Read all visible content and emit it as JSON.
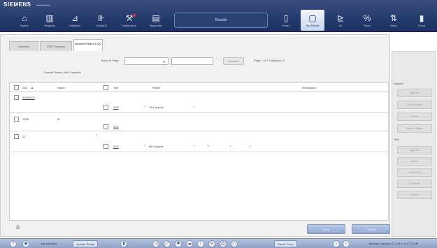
{
  "header": {
    "brand": "SIEMENS",
    "results_label": "Results",
    "nav_left": [
      {
        "label": "System",
        "icon": "home-icon"
      },
      {
        "label": "Reagents",
        "icon": "reagents-icon"
      },
      {
        "label": "Calibration",
        "icon": "calibration-icon"
      },
      {
        "label": "QualityCtl",
        "icon": "quality-control-icon"
      },
      {
        "label": "Maintenance",
        "icon": "maintenance-icon"
      },
      {
        "label": "Diagnostics",
        "icon": "diagnostics-icon"
      }
    ],
    "nav_right": [
      {
        "label": "Orders",
        "icon": "orders-icon"
      },
      {
        "label": "Test Results",
        "icon": "test-results-icon",
        "active": true
      },
      {
        "label": "QC",
        "icon": "qc-icon"
      },
      {
        "label": "Racks",
        "icon": "racks-icon"
      },
      {
        "label": "Status",
        "icon": "status-icon"
      },
      {
        "label": "Events",
        "icon": "events-icon"
      }
    ]
  },
  "tabs": [
    {
      "label": "Overview"
    },
    {
      "label": "STAT Samples"
    },
    {
      "label": "Worklist Patient & QC",
      "active": true
    }
  ],
  "filter": {
    "per_page_label": "Rows in Page",
    "search_button": "Retrieve",
    "page_info": "Page 1 of 1  Total pass: 3",
    "status_text": "Sample Status: Not Complete"
  },
  "table": {
    "columns": [
      "SID",
      "Name",
      "Test",
      "Result",
      "Information"
    ],
    "rows": [
      {
        "sid": "20400102",
        "name": "",
        "test": "ALB",
        "result": "19.6 mg/mL",
        "ok": "✓",
        "extra": ""
      },
      {
        "sid": "1006",
        "name": "ID",
        "test": "ALB",
        "result": "",
        "ok": "",
        "extra": ""
      },
      {
        "sid": "20",
        "name": "",
        "test": "ALB",
        "result": "86.4 mg/mL",
        "ok": "✓",
        "extra": "I"
      }
    ]
  },
  "actions": {
    "print": "Print",
    "save": "Save",
    "cancel": "Cancel"
  },
  "side": {
    "sample_header": "Sample",
    "sample_buttons": [
      "Approve",
      "Rerun/Repeat",
      "Delete",
      "Manual Dilution"
    ],
    "test_header": "Test",
    "test_buttons": [
      "Approve",
      "Rerun",
      "Manual Dil",
      "Comment",
      "Delete"
    ]
  },
  "taskbar": {
    "user": "Administrator",
    "system_state": "System Ready",
    "result_trend": "Result Trend",
    "datetime": "Monday, January 20, 2014 10:47:13 AM"
  },
  "colors": {
    "nav_bg": "#233a6b",
    "active_tab": "#e7eef9",
    "accent": "#93a9d4"
  }
}
